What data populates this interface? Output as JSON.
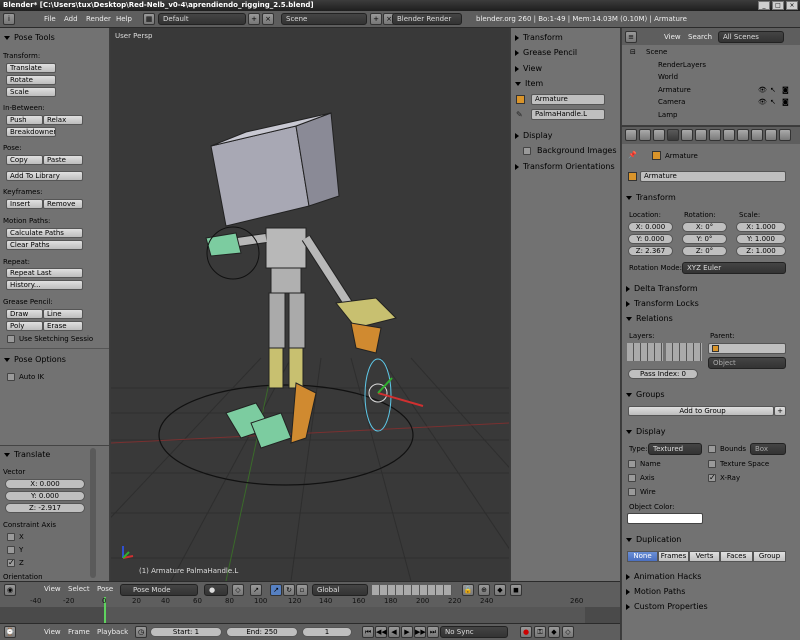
{
  "window": {
    "title": "Blender* [C:\\Users\\tux\\Desktop\\Red-Nelb_v0-4\\aprendiendo_rigging_2.5.blend]"
  },
  "info": {
    "menus": [
      "File",
      "Add",
      "Render",
      "Help"
    ],
    "layout": "Default",
    "scene": "Scene",
    "engine": "Blender Render",
    "stats": "blender.org 260 | Bo:1-49 | Mem:14.03M (0.10M) | Armature"
  },
  "tools": {
    "title": "Pose Tools",
    "transform_label": "Transform:",
    "translate": "Translate",
    "rotate": "Rotate",
    "scale": "Scale",
    "inbetween_label": "In-Between:",
    "push": "Push",
    "relax": "Relax",
    "breakdowner": "Breakdowner",
    "pose_label": "Pose:",
    "copy": "Copy",
    "paste": "Paste",
    "add_to_library": "Add To Library",
    "keyframes_label": "Keyframes:",
    "insert": "Insert",
    "remove": "Remove",
    "motion_paths_label": "Motion Paths:",
    "calculate_paths": "Calculate Paths",
    "clear_paths": "Clear Paths",
    "repeat_label": "Repeat:",
    "repeat_last": "Repeat Last",
    "history": "History...",
    "grease_label": "Grease Pencil:",
    "draw": "Draw",
    "line": "Line",
    "poly": "Poly",
    "erase": "Erase",
    "use_sketching": "Use Sketching Sessio",
    "pose_options": "Pose Options",
    "auto_ik": "Auto IK"
  },
  "operator": {
    "title": "Translate",
    "vector_label": "Vector",
    "x": "X: 0.000",
    "y": "Y: 0.000",
    "z": "Z: -2.917",
    "constraint_label": "Constraint Axis",
    "cx": "X",
    "cy": "Y",
    "cz": "Z",
    "orientation": "Orientation"
  },
  "viewport": {
    "label": "User Persp",
    "status": "(1) Armature PalmaHandle.L"
  },
  "npanel": {
    "transform": "Transform",
    "grease": "Grease Pencil",
    "view": "View",
    "item": "Item",
    "item_object": "Armature",
    "item_bone": "PalmaHandle.L",
    "display": "Display",
    "background_images": "Background Images",
    "transform_orientations": "Transform Orientations"
  },
  "outliner": {
    "view": "View",
    "search": "Search",
    "filter": "All Scenes",
    "items": [
      "Scene",
      "RenderLayers",
      "World",
      "Armature",
      "Camera",
      "Lamp"
    ]
  },
  "props": {
    "breadcrumb": "Armature",
    "object_name": "Armature",
    "transform": "Transform",
    "location_label": "Location:",
    "rotation_label": "Rotation:",
    "scale_label": "Scale:",
    "loc": [
      "X: 0.000",
      "Y: 0.000",
      "Z: 2.367"
    ],
    "rot": [
      "X: 0°",
      "Y: 0°",
      "Z: 0°"
    ],
    "scl": [
      "X: 1.000",
      "Y: 1.000",
      "Z: 1.000"
    ],
    "rotation_mode_label": "Rotation Mode:",
    "rotation_mode": "XYZ Euler",
    "delta_transform": "Delta Transform",
    "transform_locks": "Transform Locks",
    "relations": "Relations",
    "layers_label": "Layers:",
    "parent_label": "Parent:",
    "parent_type": "Object",
    "pass_index": "Pass Index: 0",
    "groups": "Groups",
    "add_to_group": "Add to Group",
    "display": "Display",
    "type_label": "Type:",
    "type_value": "Textured",
    "bounds": "Bounds",
    "bounds_type": "Box",
    "name": "Name",
    "texture_space": "Texture Space",
    "axis": "Axis",
    "xray": "X-Ray",
    "wire": "Wire",
    "object_color": "Object Color:",
    "duplication": "Duplication",
    "dup_options": [
      "None",
      "Frames",
      "Verts",
      "Faces",
      "Group"
    ],
    "animation_hacks": "Animation Hacks",
    "motion_paths": "Motion Paths",
    "custom_properties": "Custom Properties"
  },
  "vheader": {
    "view": "View",
    "select": "Select",
    "pose": "Pose",
    "mode": "Pose Mode",
    "orientation": "Global"
  },
  "timeline": {
    "ticks": [
      "-40",
      "-20",
      "0",
      "20",
      "40",
      "60",
      "80",
      "100",
      "120",
      "140",
      "160",
      "180",
      "200",
      "220",
      "240",
      "260"
    ],
    "view": "View",
    "frame": "Frame",
    "playback": "Playback",
    "start": "Start: 1",
    "end": "End: 250",
    "current": "1",
    "sync": "No Sync"
  },
  "colors": {
    "accent": "#5680c2",
    "panel": "#727272",
    "viewport": "#393939"
  }
}
